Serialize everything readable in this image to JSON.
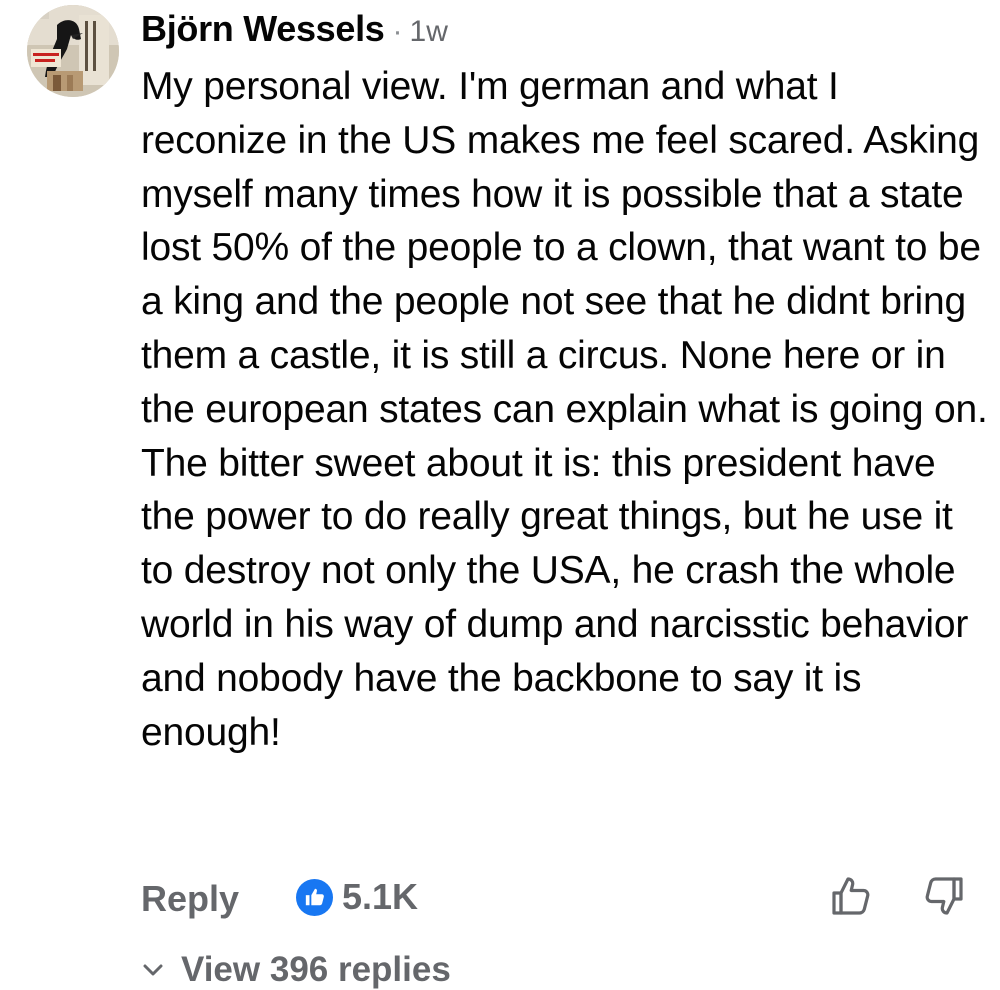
{
  "comment": {
    "author": "Björn Wessels",
    "separator": "·",
    "timestamp": "1w",
    "avatar_icon": "profile-photo-icon",
    "body": "My personal view. I'm german and what I reconize in the US makes me feel scared. Asking myself many times how it is possible that a state lost 50% of the people to a clown, that want to be a king and the people not see that he didnt bring them a castle, it is still a circus. None here or in the european states can explain what is going on. The bitter sweet about it is: this president have the power to do really great things, but he use it to destroy not only the USA, he crash the whole world in his way of dump and narcisstic behavior and nobody have the backbone to say it is enough!"
  },
  "actions": {
    "reply_label": "Reply",
    "reaction_icon": "like-badge-icon",
    "reaction_count": "5.1K",
    "upvote_icon": "thumbs-up-icon",
    "downvote_icon": "thumbs-down-icon"
  },
  "replies": {
    "icon": "chevron-down-icon",
    "label": "View 396 replies"
  },
  "colors": {
    "text_primary": "#050505",
    "text_secondary": "#65676b",
    "like_blue": "#1877f2"
  }
}
